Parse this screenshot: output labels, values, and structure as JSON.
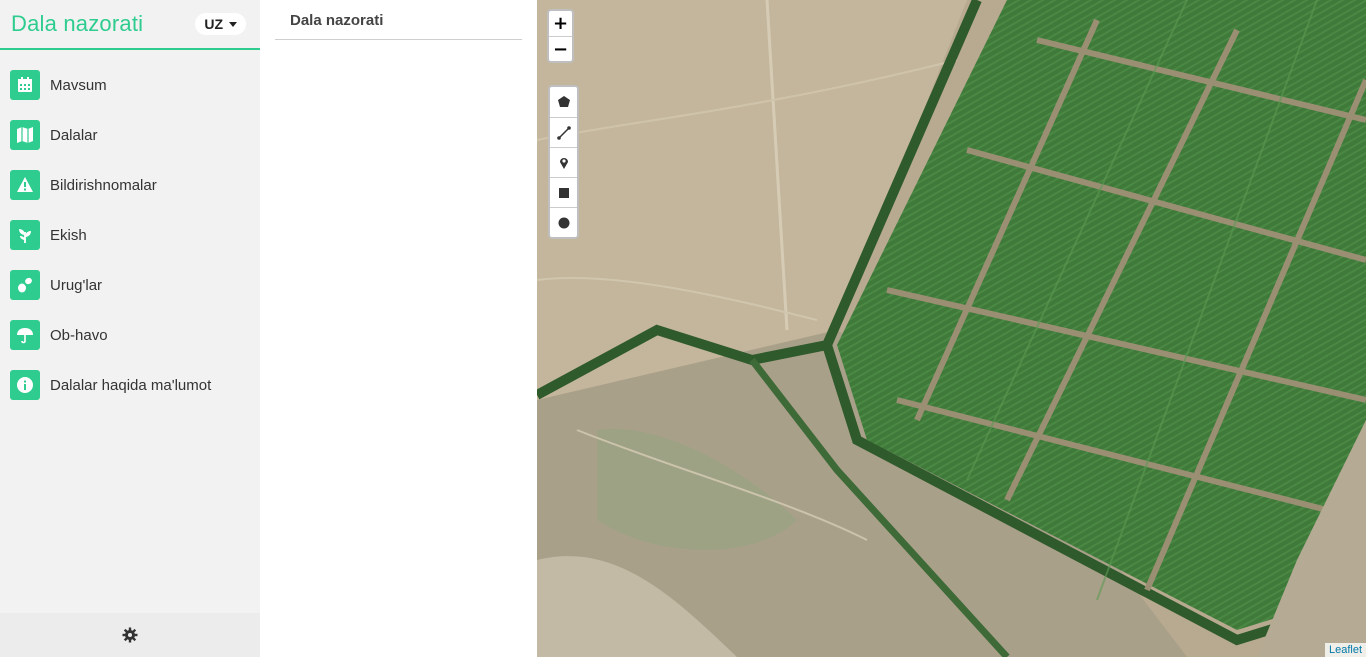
{
  "header": {
    "app_title": "Dala nazorati",
    "language": "UZ"
  },
  "sidebar": {
    "items": [
      {
        "label": "Mavsum",
        "icon": "calendar-icon"
      },
      {
        "label": "Dalalar",
        "icon": "map-icon"
      },
      {
        "label": "Bildirishnomalar",
        "icon": "warning-icon"
      },
      {
        "label": "Ekish",
        "icon": "plant-icon"
      },
      {
        "label": "Urug'lar",
        "icon": "seeds-icon"
      },
      {
        "label": "Ob-havo",
        "icon": "umbrella-icon"
      },
      {
        "label": "Dalalar haqida ma'lumot",
        "icon": "info-icon"
      }
    ],
    "footer_icon": "gear-icon"
  },
  "panel": {
    "title": "Dala nazorati"
  },
  "map": {
    "zoom_in": "+",
    "zoom_out": "−",
    "draw_tools": [
      "polygon-icon",
      "polyline-icon",
      "marker-icon",
      "rectangle-icon",
      "circle-icon"
    ],
    "attribution": "Leaflet"
  },
  "colors": {
    "accent": "#2ecc8f",
    "sidebar_bg": "#f2f2f2"
  }
}
